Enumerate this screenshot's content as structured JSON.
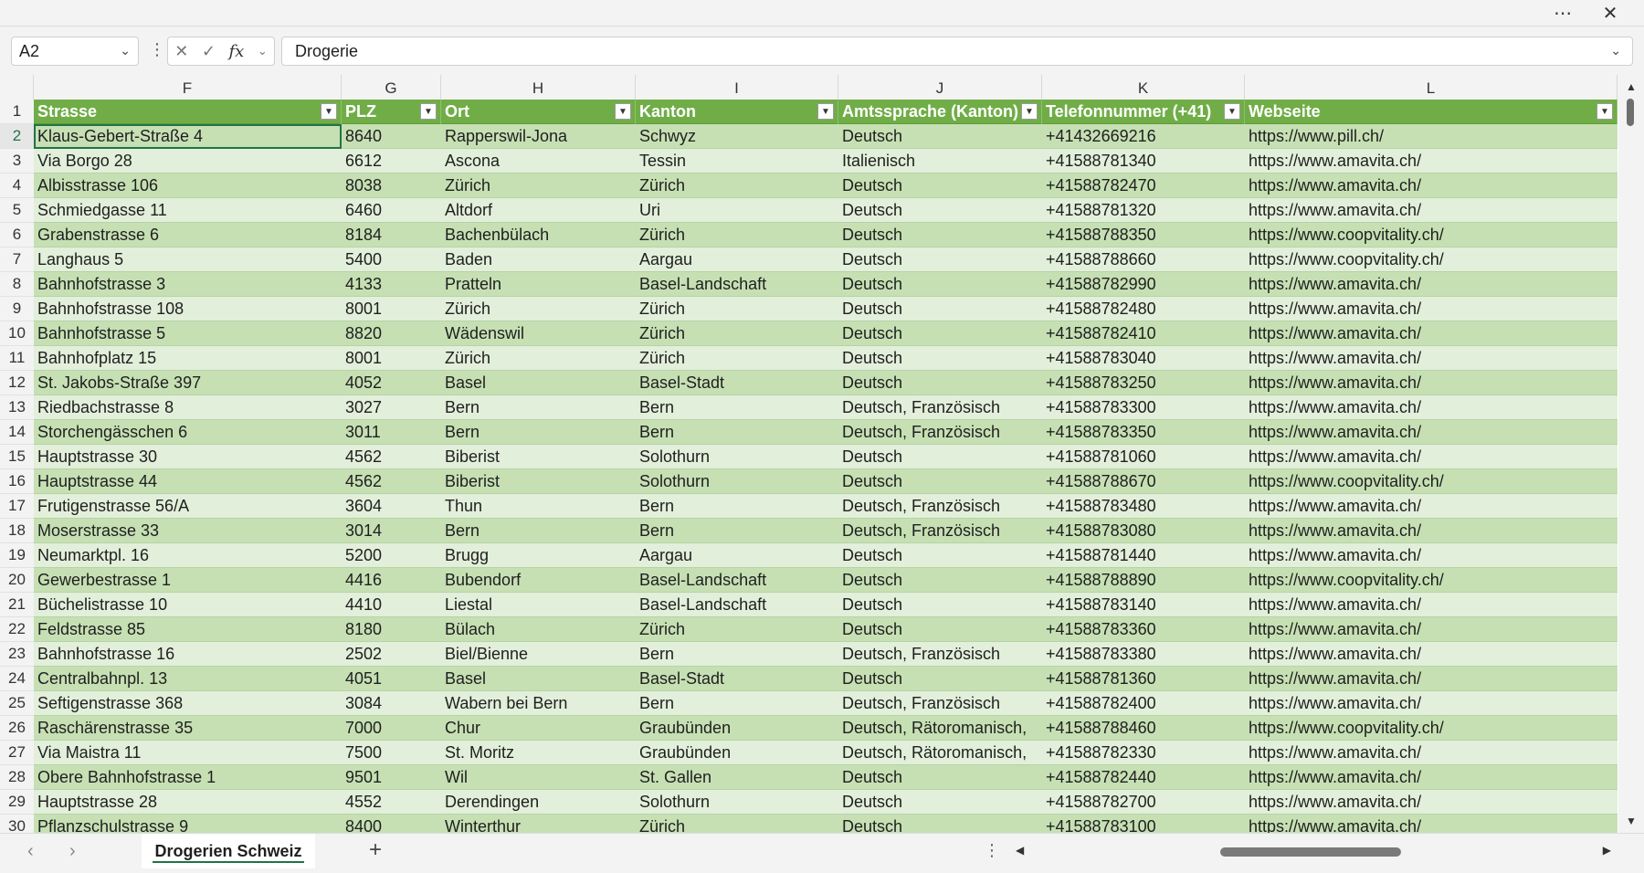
{
  "titlebar": {
    "more_icon": "ellipsis-icon",
    "close_icon": "close-icon"
  },
  "namebox": {
    "value": "A2"
  },
  "formula_bar": {
    "fx_label": "fx",
    "value": "Drogerie"
  },
  "columns": [
    {
      "letter": "F",
      "header": "Strasse"
    },
    {
      "letter": "G",
      "header": "PLZ"
    },
    {
      "letter": "H",
      "header": "Ort"
    },
    {
      "letter": "I",
      "header": "Kanton"
    },
    {
      "letter": "J",
      "header": "Amtssprache (Kanton)"
    },
    {
      "letter": "K",
      "header": "Telefonnummer (+41)"
    },
    {
      "letter": "L",
      "header": "Webseite"
    }
  ],
  "header_row_number": "1",
  "rows": [
    {
      "n": "2",
      "cells": [
        "Klaus-Gebert-Straße 4",
        "8640",
        "Rapperswil-Jona",
        "Schwyz",
        "Deutsch",
        "+41432669216",
        "https://www.pill.ch/"
      ]
    },
    {
      "n": "3",
      "cells": [
        "Via Borgo 28",
        "6612",
        "Ascona",
        "Tessin",
        "Italienisch",
        "+41588781340",
        "https://www.amavita.ch/"
      ]
    },
    {
      "n": "4",
      "cells": [
        "Albisstrasse 106",
        "8038",
        "Zürich",
        "Zürich",
        "Deutsch",
        "+41588782470",
        "https://www.amavita.ch/"
      ]
    },
    {
      "n": "5",
      "cells": [
        "Schmiedgasse 11",
        "6460",
        "Altdorf",
        "Uri",
        "Deutsch",
        "+41588781320",
        "https://www.amavita.ch/"
      ]
    },
    {
      "n": "6",
      "cells": [
        "Grabenstrasse 6",
        "8184",
        "Bachenbülach",
        "Zürich",
        "Deutsch",
        "+41588788350",
        "https://www.coopvitality.ch/"
      ]
    },
    {
      "n": "7",
      "cells": [
        "Langhaus 5",
        "5400",
        "Baden",
        "Aargau",
        "Deutsch",
        "+41588788660",
        "https://www.coopvitality.ch/"
      ]
    },
    {
      "n": "8",
      "cells": [
        "Bahnhofstrasse 3",
        "4133",
        "Pratteln",
        "Basel-Landschaft",
        "Deutsch",
        "+41588782990",
        "https://www.amavita.ch/"
      ]
    },
    {
      "n": "9",
      "cells": [
        "Bahnhofstrasse 108",
        "8001",
        "Zürich",
        "Zürich",
        "Deutsch",
        "+41588782480",
        "https://www.amavita.ch/"
      ]
    },
    {
      "n": "10",
      "cells": [
        "Bahnhofstrasse 5",
        "8820",
        "Wädenswil",
        "Zürich",
        "Deutsch",
        "+41588782410",
        "https://www.amavita.ch/"
      ]
    },
    {
      "n": "11",
      "cells": [
        "Bahnhofplatz 15",
        "8001",
        "Zürich",
        "Zürich",
        "Deutsch",
        "+41588783040",
        "https://www.amavita.ch/"
      ]
    },
    {
      "n": "12",
      "cells": [
        "St. Jakobs-Straße 397",
        "4052",
        "Basel",
        "Basel-Stadt",
        "Deutsch",
        "+41588783250",
        "https://www.amavita.ch/"
      ]
    },
    {
      "n": "13",
      "cells": [
        "Riedbachstrasse 8",
        "3027",
        "Bern",
        "Bern",
        "Deutsch, Französisch",
        "+41588783300",
        "https://www.amavita.ch/"
      ]
    },
    {
      "n": "14",
      "cells": [
        "Storchengässchen 6",
        "3011",
        "Bern",
        "Bern",
        "Deutsch, Französisch",
        "+41588783350",
        "https://www.amavita.ch/"
      ]
    },
    {
      "n": "15",
      "cells": [
        "Hauptstrasse 30",
        "4562",
        "Biberist",
        "Solothurn",
        "Deutsch",
        "+41588781060",
        "https://www.amavita.ch/"
      ]
    },
    {
      "n": "16",
      "cells": [
        "Hauptstrasse 44",
        "4562",
        "Biberist",
        "Solothurn",
        "Deutsch",
        "+41588788670",
        "https://www.coopvitality.ch/"
      ]
    },
    {
      "n": "17",
      "cells": [
        "Frutigenstrasse 56/A",
        "3604",
        "Thun",
        "Bern",
        "Deutsch, Französisch",
        "+41588783480",
        "https://www.amavita.ch/"
      ]
    },
    {
      "n": "18",
      "cells": [
        "Moserstrasse 33",
        "3014",
        "Bern",
        "Bern",
        "Deutsch, Französisch",
        "+41588783080",
        "https://www.amavita.ch/"
      ]
    },
    {
      "n": "19",
      "cells": [
        "Neumarktpl. 16",
        "5200",
        "Brugg",
        "Aargau",
        "Deutsch",
        "+41588781440",
        "https://www.amavita.ch/"
      ]
    },
    {
      "n": "20",
      "cells": [
        "Gewerbestrasse 1",
        "4416",
        "Bubendorf",
        "Basel-Landschaft",
        "Deutsch",
        "+41588788890",
        "https://www.coopvitality.ch/"
      ]
    },
    {
      "n": "21",
      "cells": [
        "Büchelistrasse 10",
        "4410",
        "Liestal",
        "Basel-Landschaft",
        "Deutsch",
        "+41588783140",
        "https://www.amavita.ch/"
      ]
    },
    {
      "n": "22",
      "cells": [
        "Feldstrasse 85",
        "8180",
        "Bülach",
        "Zürich",
        "Deutsch",
        "+41588783360",
        "https://www.amavita.ch/"
      ]
    },
    {
      "n": "23",
      "cells": [
        "Bahnhofstrasse 16",
        "2502",
        "Biel/Bienne",
        "Bern",
        "Deutsch, Französisch",
        "+41588783380",
        "https://www.amavita.ch/"
      ]
    },
    {
      "n": "24",
      "cells": [
        "Centralbahnpl. 13",
        "4051",
        "Basel",
        "Basel-Stadt",
        "Deutsch",
        "+41588781360",
        "https://www.amavita.ch/"
      ]
    },
    {
      "n": "25",
      "cells": [
        "Seftigenstrasse 368",
        "3084",
        "Wabern bei Bern",
        "Bern",
        "Deutsch, Französisch",
        "+41588782400",
        "https://www.amavita.ch/"
      ]
    },
    {
      "n": "26",
      "cells": [
        "Raschärenstrasse 35",
        "7000",
        "Chur",
        "Graubünden",
        "Deutsch, Rätoromanisch,",
        "+41588788460",
        "https://www.coopvitality.ch/"
      ]
    },
    {
      "n": "27",
      "cells": [
        "Via Maistra 11",
        "7500",
        "St. Moritz",
        "Graubünden",
        "Deutsch, Rätoromanisch,",
        "+41588782330",
        "https://www.amavita.ch/"
      ]
    },
    {
      "n": "28",
      "cells": [
        "Obere Bahnhofstrasse 1",
        "9501",
        "Wil",
        "St. Gallen",
        "Deutsch",
        "+41588782440",
        "https://www.amavita.ch/"
      ]
    },
    {
      "n": "29",
      "cells": [
        "Hauptstrasse 28",
        "4552",
        "Derendingen",
        "Solothurn",
        "Deutsch",
        "+41588782700",
        "https://www.amavita.ch/"
      ]
    },
    {
      "n": "30",
      "cells": [
        "Pflanzschulstrasse 9",
        "8400",
        "Winterthur",
        "Zürich",
        "Deutsch",
        "+41588783100",
        "https://www.amavita.ch/"
      ]
    }
  ],
  "sheet_tab": {
    "label": "Drogerien Schweiz"
  },
  "add_sheet": "+",
  "colors": {
    "header_green": "#70ad47",
    "band_dark": "#c6e0b4",
    "band_light": "#e2efda",
    "accent": "#217346"
  }
}
